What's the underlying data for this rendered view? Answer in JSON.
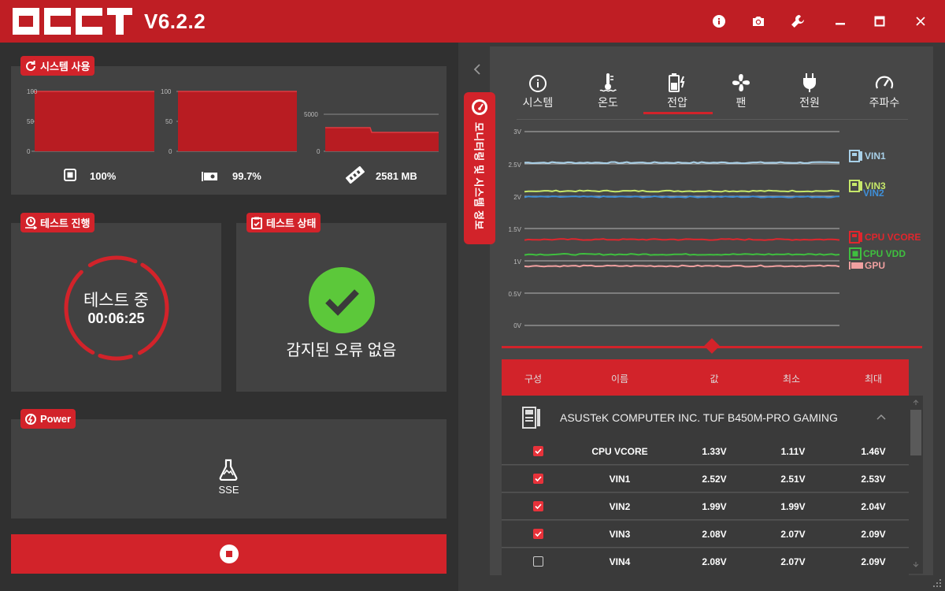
{
  "app": {
    "logo": "OCCT",
    "version": "V6.2.2"
  },
  "titlebar": {
    "icons": [
      "info-icon",
      "camera-icon",
      "wrench-icon",
      "minimize-icon",
      "maximize-icon",
      "close-icon"
    ]
  },
  "system_usage": {
    "title": "시스템 사용",
    "cpu": {
      "value": "100%",
      "axis": [
        "100",
        "50",
        "0"
      ]
    },
    "gpu": {
      "value": "99.7%",
      "axis": [
        "100",
        "50",
        "0"
      ]
    },
    "ram": {
      "value": "2581 MB",
      "axis": [
        "5000",
        "0"
      ]
    }
  },
  "test_progress": {
    "title": "테스트 진행",
    "status": "테스트 중",
    "time": "00:06:25"
  },
  "test_status": {
    "title": "테스트 상태",
    "message": "감지된 오류 없음"
  },
  "power": {
    "title": "Power",
    "mode": "SSE"
  },
  "side_tab": {
    "label": "모니터링 및 시스템 정보"
  },
  "categories": [
    {
      "label": "시스템",
      "icon": "info-icon"
    },
    {
      "label": "온도",
      "icon": "thermometer-icon"
    },
    {
      "label": "전압",
      "icon": "battery-icon",
      "active": true
    },
    {
      "label": "팬",
      "icon": "fan-icon"
    },
    {
      "label": "전원",
      "icon": "plug-icon"
    },
    {
      "label": "주파수",
      "icon": "gauge-icon"
    }
  ],
  "chart_data": {
    "type": "line",
    "y_ticks": [
      "3V",
      "2.5V",
      "2V",
      "1.5V",
      "1V",
      "0.5V",
      "0V"
    ],
    "ylim": [
      0,
      3
    ],
    "series": [
      {
        "name": "VIN1",
        "value": 2.52,
        "color": "#a8d0e8"
      },
      {
        "name": "VIN3",
        "value": 2.08,
        "color": "#c6e86a"
      },
      {
        "name": "VIN2",
        "value": 1.99,
        "color": "#3f8fd8"
      },
      {
        "name": "CPU VCORE",
        "value": 1.33,
        "color": "#e0262d"
      },
      {
        "name": "CPU VDD",
        "value": 1.1,
        "color": "#3fbf3f"
      },
      {
        "name": "GPU",
        "value": 0.92,
        "color": "#f0a0a0"
      }
    ]
  },
  "table": {
    "headers": [
      "구성",
      "이름",
      "값",
      "최소",
      "최대"
    ],
    "group": "ASUSTeK COMPUTER INC. TUF B450M-PRO GAMING",
    "rows": [
      {
        "name": "CPU VCORE",
        "value": "1.33V",
        "min": "1.11V",
        "max": "1.46V",
        "checked": true
      },
      {
        "name": "VIN1",
        "value": "2.52V",
        "min": "2.51V",
        "max": "2.53V",
        "checked": true
      },
      {
        "name": "VIN2",
        "value": "1.99V",
        "min": "1.99V",
        "max": "2.04V",
        "checked": true
      },
      {
        "name": "VIN3",
        "value": "2.08V",
        "min": "2.07V",
        "max": "2.09V",
        "checked": true
      },
      {
        "name": "VIN4",
        "value": "2.08V",
        "min": "2.07V",
        "max": "2.09V",
        "checked": false
      }
    ]
  },
  "colors": {
    "accent": "#d2232a",
    "success": "#5cc83a"
  }
}
